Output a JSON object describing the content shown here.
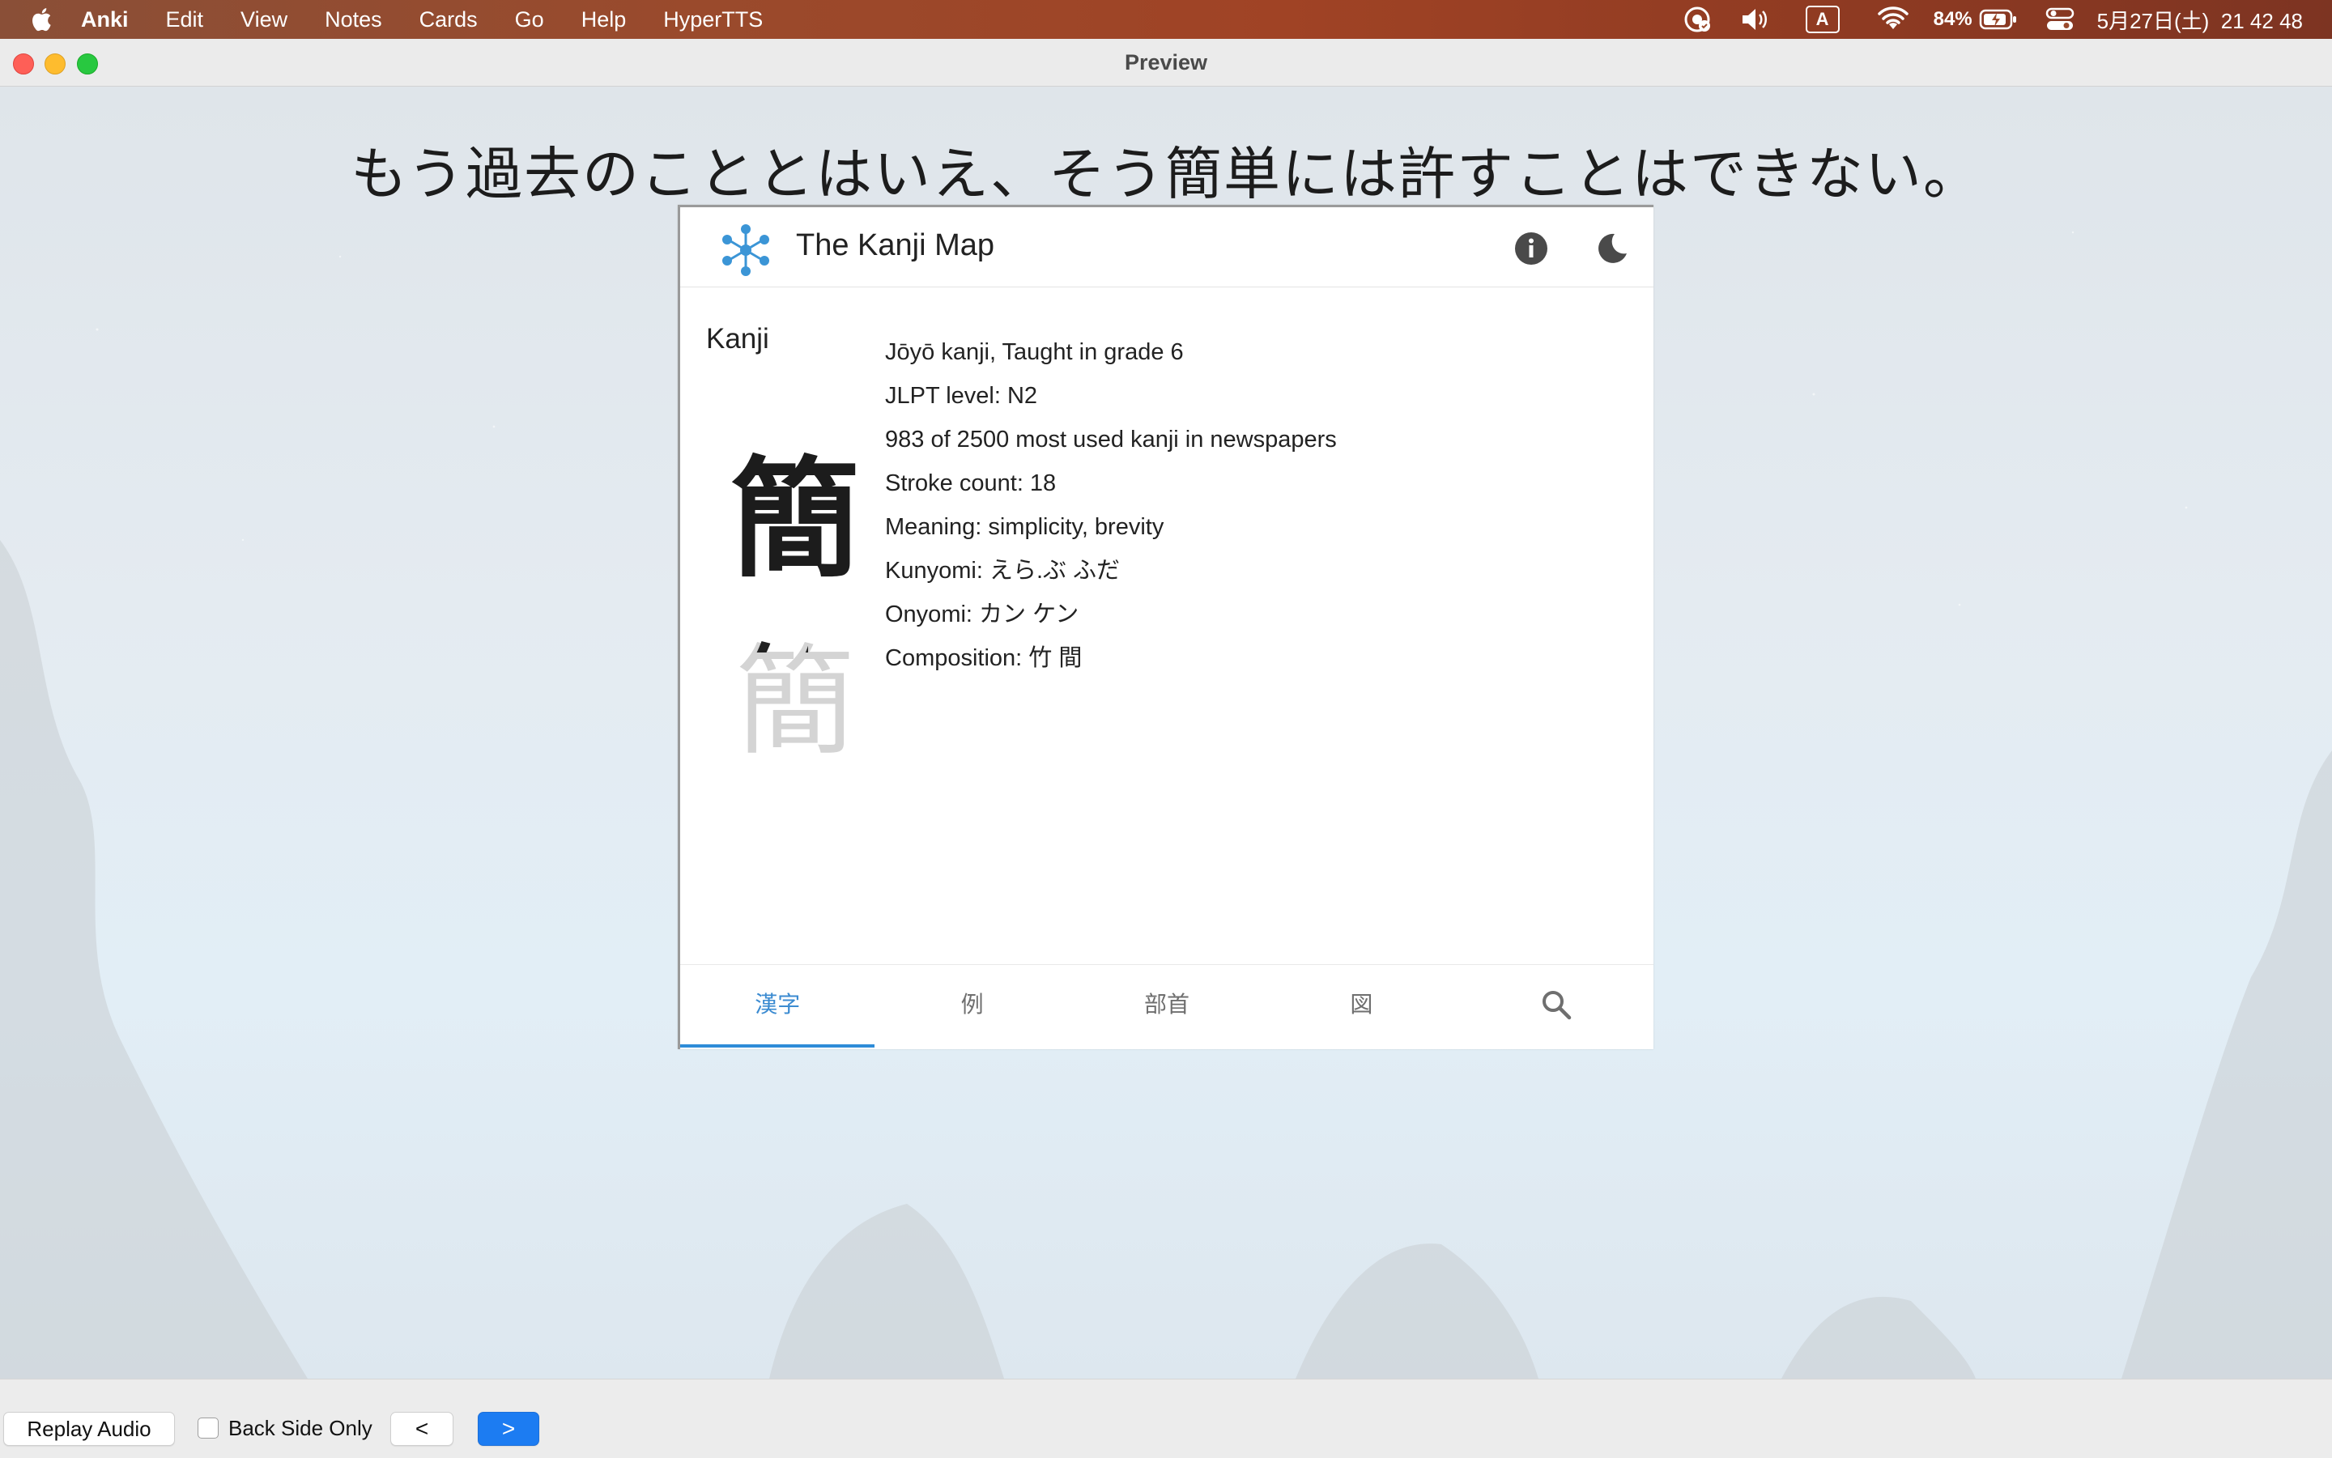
{
  "menubar": {
    "app_name": "Anki",
    "items": [
      "Edit",
      "View",
      "Notes",
      "Cards",
      "Go",
      "Help",
      "HyperTTS"
    ],
    "status": {
      "input_source": "A",
      "battery": "84%",
      "datetime": "5月27日(土)  21 42 48"
    }
  },
  "window": {
    "title": "Preview"
  },
  "card": {
    "sentence": "もう過去のこととはいえ、そう簡単には許すことはできない。"
  },
  "kanji_map": {
    "title": "The Kanji Map",
    "section_label": "Kanji",
    "kanji": "簡",
    "stroke_preview": "簡",
    "stroke_preview_drawn": "𥫗",
    "info": [
      "Jōyō kanji, Taught in grade 6",
      "JLPT level: N2",
      "983 of 2500 most used kanji in newspapers",
      "Stroke count: 18",
      "Meaning: simplicity, brevity",
      "Kunyomi: えら.ぶ ふだ",
      "Onyomi: カン ケン",
      "Composition: 竹 間"
    ],
    "tabs": [
      "漢字",
      "例",
      "部首",
      "図",
      "search-icon"
    ],
    "accent_color": "#2e8cd8"
  },
  "toolbar": {
    "replay_label": "Replay Audio",
    "back_side_label": "Back Side Only",
    "back_side_checked": false,
    "prev_label": "<",
    "next_label": ">"
  }
}
